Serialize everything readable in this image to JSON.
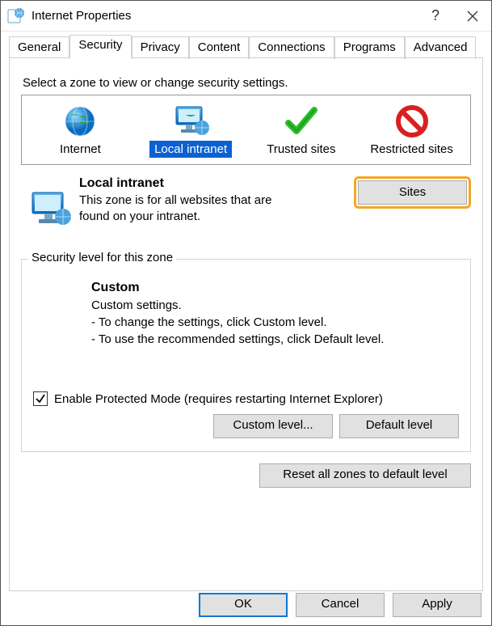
{
  "title": "Internet Properties",
  "tabs": [
    "General",
    "Security",
    "Privacy",
    "Content",
    "Connections",
    "Programs",
    "Advanced"
  ],
  "active_tab": 1,
  "instruction": "Select a zone to view or change security settings.",
  "zones": [
    {
      "label": "Internet",
      "icon": "globe"
    },
    {
      "label": "Local intranet",
      "icon": "monitor"
    },
    {
      "label": "Trusted sites",
      "icon": "check"
    },
    {
      "label": "Restricted sites",
      "icon": "forbidden"
    }
  ],
  "selected_zone": 1,
  "detail": {
    "header": "Local intranet",
    "desc": "This zone is for all websites that are found on your intranet."
  },
  "sites_btn": "Sites",
  "security_group": "Security level for this zone",
  "custom": {
    "title": "Custom",
    "l1": "Custom settings.",
    "l2": "- To change the settings, click Custom level.",
    "l3": "- To use the recommended settings, click Default level."
  },
  "protected_mode": {
    "checked": true,
    "label": "Enable Protected Mode (requires restarting Internet Explorer)"
  },
  "custom_level_btn": "Custom level...",
  "default_level_btn": "Default level",
  "reset_btn": "Reset all zones to default level",
  "footer": {
    "ok": "OK",
    "cancel": "Cancel",
    "apply": "Apply"
  }
}
